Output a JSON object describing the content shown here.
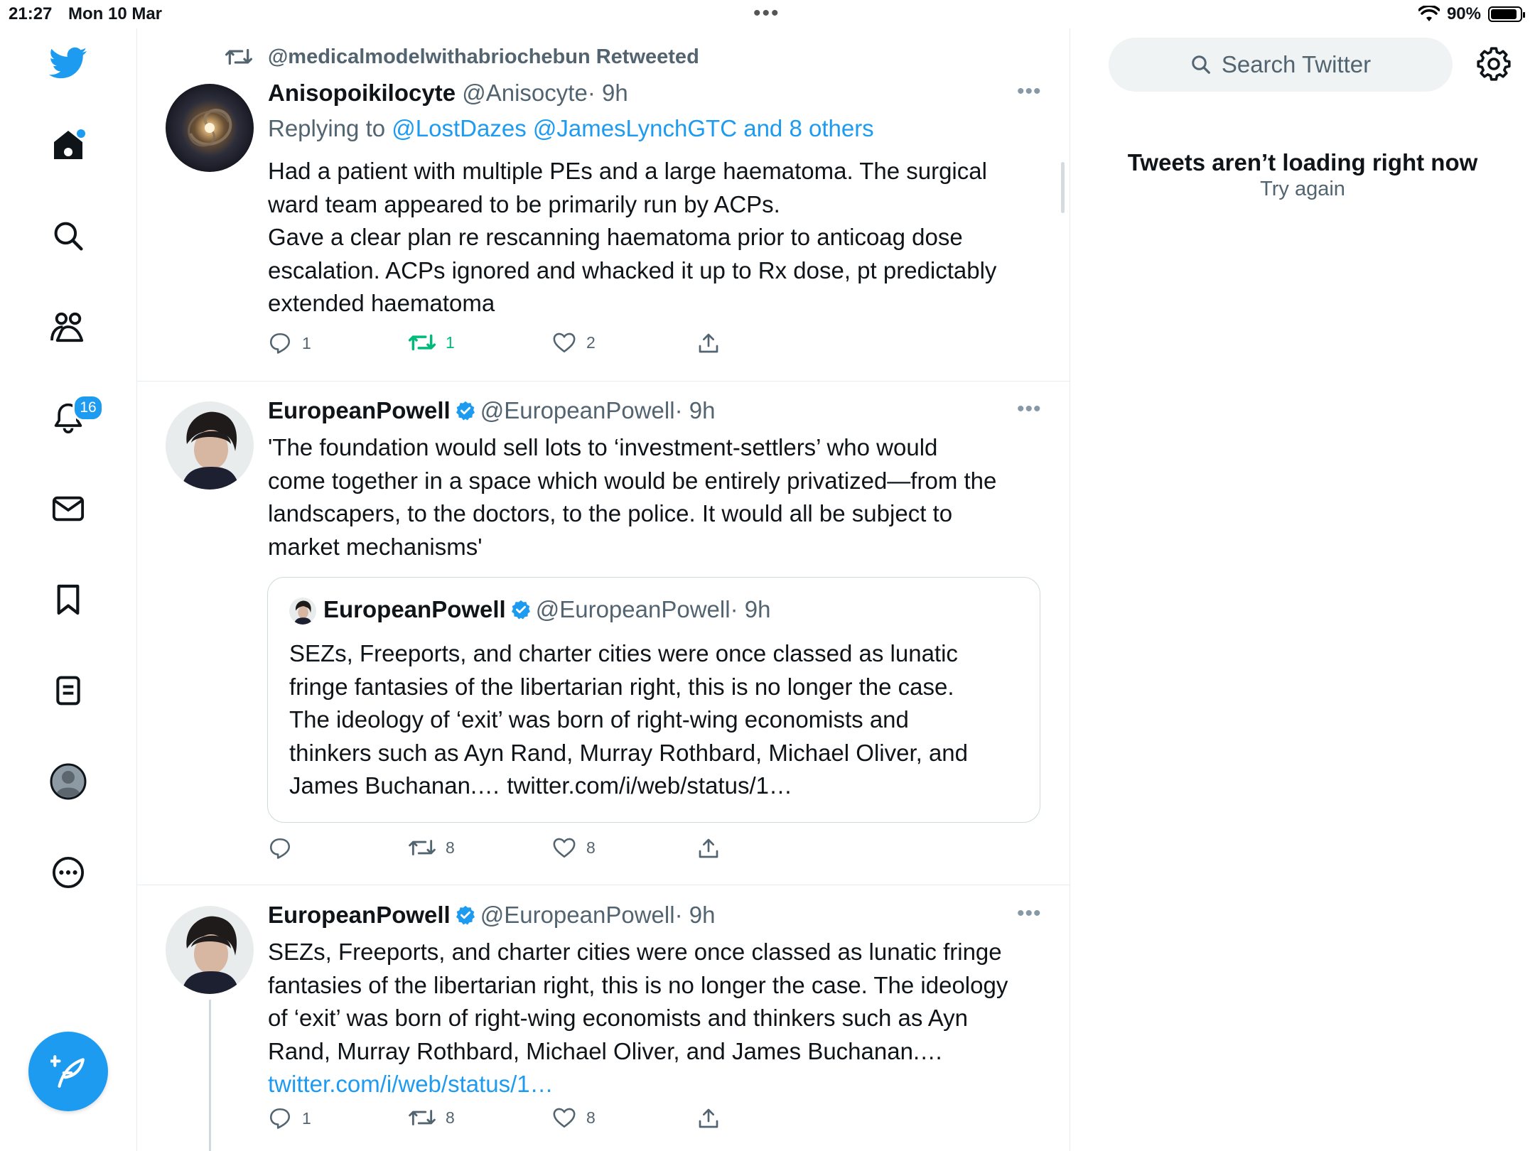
{
  "status_bar": {
    "time": "21:27",
    "date": "Mon 10 Mar",
    "battery": "90%",
    "battery_level": 0.9
  },
  "sidebar": {
    "notifications_badge": "16",
    "items": [
      "home-icon",
      "search-icon",
      "communities-icon",
      "notifications-icon",
      "messages-icon",
      "bookmarks-icon",
      "lists-icon",
      "profile-icon",
      "more-icon"
    ]
  },
  "tweets": [
    {
      "retweeted_by": "@medicalmodelwithabriochebun Retweeted",
      "name": "Anisopoikilocyte",
      "handle": "@Anisocyte",
      "time": "· 9h",
      "replying_prefix": "Replying to",
      "replying_to": "@LostDazes @JamesLynchGTC and 8 others",
      "text_lines": [
        "Had a patient with multiple PEs and a large haematoma. The surgical",
        "ward team appeared to be primarily run by ACPs.",
        "Gave a clear plan re rescanning haematoma prior to anticoag dose",
        "escalation. ACPs ignored and whacked it up to Rx dose, pt predictably",
        "extended haematoma"
      ],
      "replies": "1",
      "retweets": "1",
      "likes": "2"
    },
    {
      "name": "EuropeanPowell",
      "handle": "@EuropeanPowell",
      "time": "· 9h",
      "text_lines": [
        "'The foundation would sell lots to ‘investment-settlers’ who would",
        "come together in a space which would be entirely privatized—from the",
        "landscapers, to the doctors, to the police. It would all be subject to",
        "market mechanisms'"
      ],
      "quote": {
        "name": "EuropeanPowell",
        "handle": "@EuropeanPowell",
        "time": "· 9h",
        "text_lines": [
          "SEZs, Freeports, and charter cities were once classed as lunatic",
          "fringe fantasies of the libertarian right, this is no longer the case.",
          "The ideology of ‘exit’ was born of right-wing economists and",
          "thinkers such as Ayn Rand, Murray Rothbard, Michael Oliver, and",
          "James Buchanan.… twitter.com/i/web/status/1…"
        ]
      },
      "replies": "",
      "retweets": "8",
      "likes": "8"
    },
    {
      "name": "EuropeanPowell",
      "handle": "@EuropeanPowell",
      "time": "· 9h",
      "text_lines": [
        "SEZs, Freeports, and charter cities were once classed as lunatic fringe",
        "fantasies of the libertarian right, this is no longer the case. The ideology",
        "of ‘exit’ was born of right-wing economists and thinkers such as Ayn",
        "Rand, Murray Rothbard, Michael Oliver, and James Buchanan.…"
      ],
      "link": "twitter.com/i/web/status/1…",
      "replies": "1",
      "retweets": "8",
      "likes": "8"
    }
  ],
  "right_panel": {
    "search_placeholder": "Search Twitter",
    "error_title": "Tweets aren’t loading right now",
    "retry": "Try again"
  },
  "colors": {
    "accent": "#1d9bf0",
    "retweet_green": "#00ba7c",
    "muted": "#536471"
  }
}
